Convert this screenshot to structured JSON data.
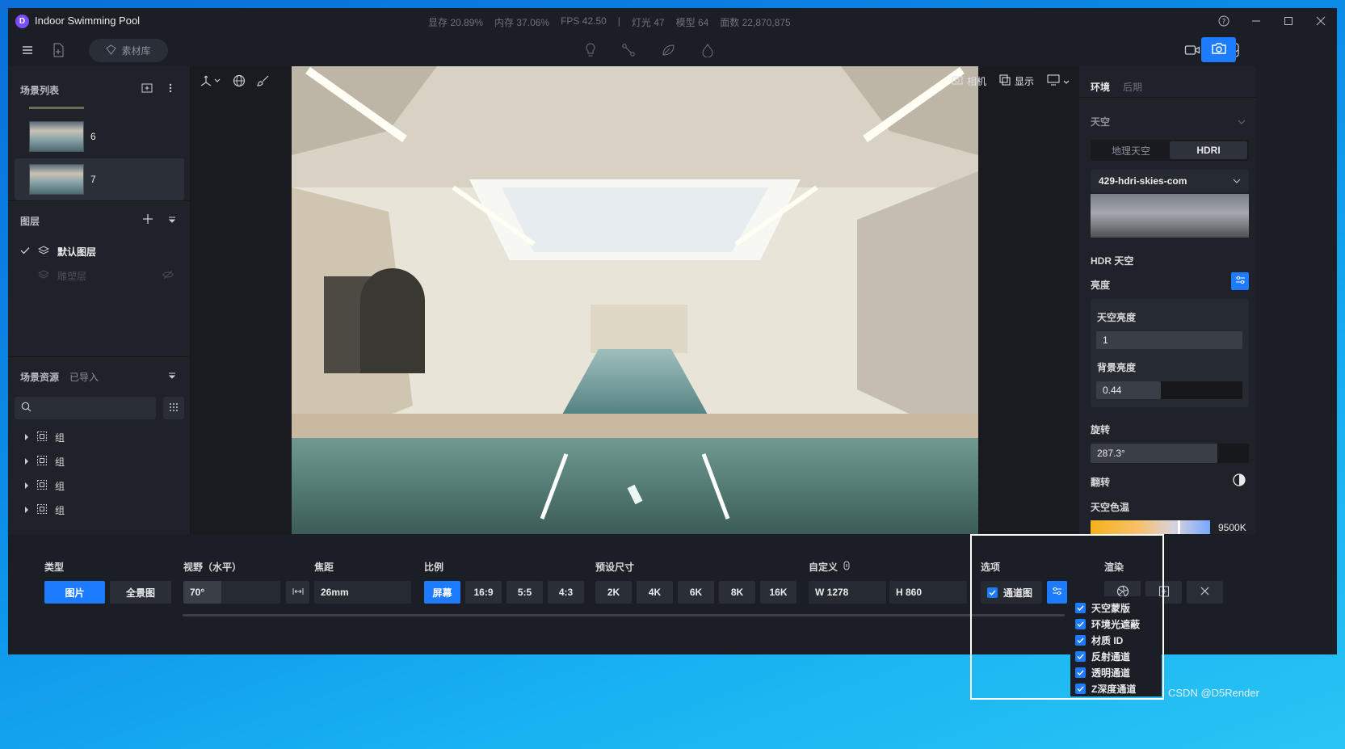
{
  "app": {
    "title": "Indoor Swimming Pool",
    "stats": [
      "显存 20.89%",
      "内存 37.06%",
      "FPS 42.50",
      "|",
      "灯光 47",
      "模型 64",
      "面数 22,870,875"
    ],
    "material_library": "素材库"
  },
  "left": {
    "scene_list_title": "场景列表",
    "scenes": [
      {
        "label": "6"
      },
      {
        "label": "7"
      }
    ],
    "layers_title": "图层",
    "layers": [
      {
        "label": "默认图层"
      },
      {
        "label": "雕塑层"
      }
    ],
    "assets_title": "场景资源",
    "assets_tab": "已导入",
    "tree": [
      {
        "label": "组"
      },
      {
        "label": "组"
      },
      {
        "label": "组"
      },
      {
        "label": "组"
      }
    ]
  },
  "viewport": {
    "camera_label": "相机",
    "display_label": "显示"
  },
  "right": {
    "tabs": [
      "环境",
      "后期"
    ],
    "sky_title": "天空",
    "sky_modes": [
      "地理天空",
      "HDRI"
    ],
    "hdri_name": "429-hdri-skies-com",
    "hdr_sky": "HDR 天空",
    "brightness": "亮度",
    "sky_brightness_label": "天空亮度",
    "sky_brightness": "1",
    "bg_brightness_label": "背景亮度",
    "bg_brightness": "0.44",
    "rotation_label": "旋转",
    "rotation": "287.3°",
    "flip_label": "翻转",
    "temp_label": "天空色温",
    "temp": "9500K"
  },
  "bottom": {
    "type_label": "类型",
    "types": [
      "图片",
      "全景图"
    ],
    "fov_label": "视野（水平）",
    "fov": "70°",
    "focal_label": "焦距",
    "focal": "26mm",
    "ratio_label": "比例",
    "ratios": [
      "屏幕",
      "16:9",
      "5:5",
      "4:3"
    ],
    "preset_label": "预设尺寸",
    "presets": [
      "2K",
      "4K",
      "6K",
      "8K",
      "16K"
    ],
    "custom_label": "自定义",
    "width": "W 1278",
    "height": "H 860",
    "options_label": "选项",
    "channel": "通道图",
    "render_label": "渲染",
    "options": [
      "天空蒙版",
      "环境光遮蔽",
      "材质 ID",
      "反射通道",
      "透明通道",
      "Z深度通道"
    ]
  },
  "watermark": "CSDN @D5Render",
  "colors": {
    "accent": "#1d7bff",
    "panel": "#1f2228",
    "bg": "#1b1e24"
  }
}
